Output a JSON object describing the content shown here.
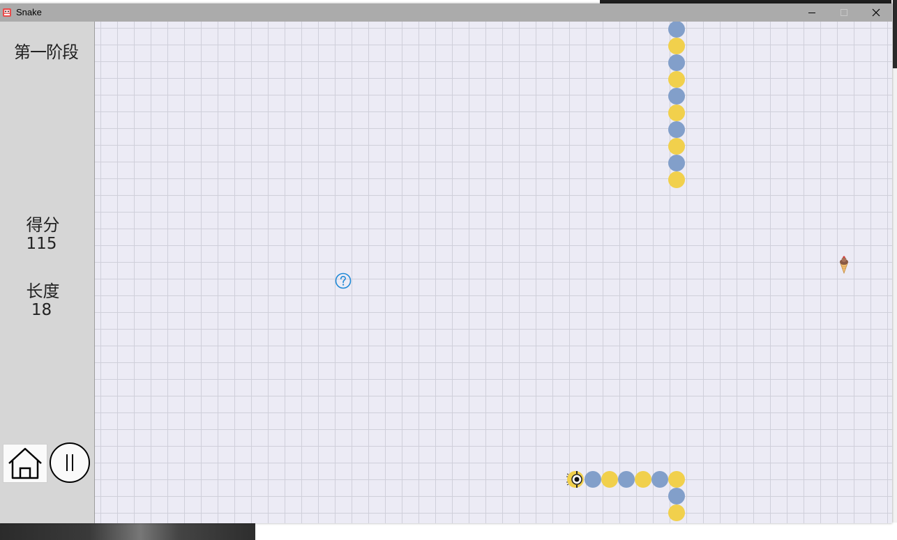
{
  "window": {
    "title": "Snake",
    "controls": {
      "minimize": "—",
      "maximize": "☐",
      "close": "✕"
    }
  },
  "sidebar": {
    "stage_label": "第一阶段",
    "score_label": "得分",
    "score_value": "115",
    "length_label": "长度",
    "length_value": "18",
    "home_icon": "home-icon",
    "pause_icon": "pause-icon"
  },
  "board": {
    "snake_length": 18,
    "colors": {
      "background": "#ecebf5",
      "grid_line": "#cfcfda",
      "blue_segment": "#829fca",
      "yellow_segment": "#f1d04c",
      "help_icon": "#1e88d6"
    },
    "items": [
      "help-icon",
      "ice-cream-icon"
    ]
  }
}
